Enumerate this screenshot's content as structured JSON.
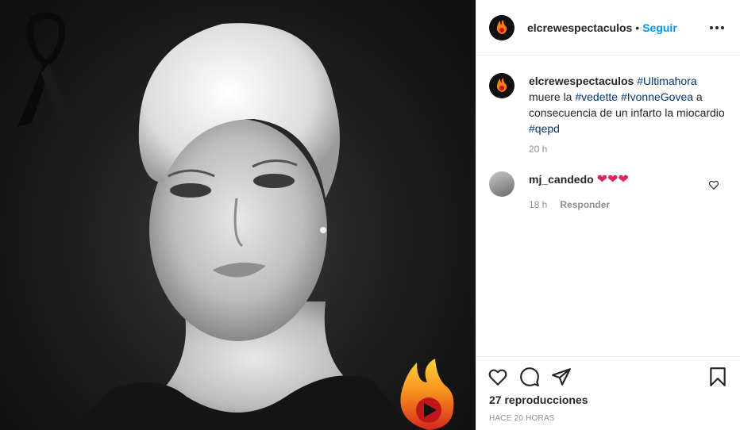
{
  "post": {
    "username": "elcrewespectaculos",
    "follow_label": "Seguir",
    "separator": "•",
    "caption": {
      "username": "elcrewespectaculos",
      "tag1": "#Ultimahora",
      "text1": "muere la ",
      "tag2": "#vedette",
      "tag3": "#IvonneGovea",
      "text2": " a consecuencia de un infarto la miocardio ",
      "tag4": "#qepd",
      "time": "20 h"
    },
    "comment": {
      "username": "mj_candedo",
      "text": "❤❤❤",
      "time": "18 h",
      "reply_label": "Responder"
    },
    "views": "27 reproducciones",
    "posted_ago": "HACE 20 HORAS"
  },
  "colors": {
    "link": "#0095f6",
    "hashtag": "#00376b",
    "muted": "#8e8e8e"
  },
  "icons": [
    "mourning-ribbon-icon",
    "flame-logo-icon",
    "more-options-icon",
    "heart-icon",
    "comment-icon",
    "share-icon",
    "bookmark-icon"
  ]
}
